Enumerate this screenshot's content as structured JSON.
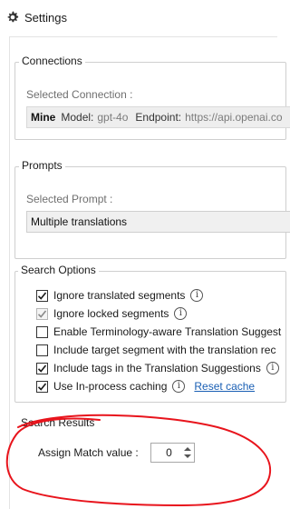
{
  "window": {
    "title": "Settings",
    "icon": "gear-icon"
  },
  "connections": {
    "legend": "Connections",
    "selected_label": "Selected Connection :",
    "name": "Mine",
    "model_key": "Model:",
    "model_value": "gpt-4o",
    "endpoint_key": "Endpoint:",
    "endpoint_value": "https://api.openai.co"
  },
  "prompts": {
    "legend": "Prompts",
    "selected_label": "Selected Prompt :",
    "selected_value": "Multiple translations"
  },
  "search_options": {
    "legend": "Search Options",
    "items": [
      {
        "label": "Ignore translated segments",
        "checked": true,
        "disabled": false,
        "info": true
      },
      {
        "label": "Ignore locked segments",
        "checked": true,
        "disabled": true,
        "info": true
      },
      {
        "label": "Enable Terminology-aware Translation Suggest",
        "checked": false,
        "disabled": false,
        "info": false
      },
      {
        "label": "Include target segment with the translation rec",
        "checked": false,
        "disabled": false,
        "info": false
      },
      {
        "label": "Include tags in the Translation Suggestions",
        "checked": true,
        "disabled": false,
        "info": true
      },
      {
        "label": "Use In-process caching",
        "checked": true,
        "disabled": false,
        "info": true
      }
    ],
    "reset_cache_label": "Reset cache"
  },
  "search_results": {
    "legend": "Search Results",
    "match_label": "Assign Match value :",
    "match_value": "0"
  },
  "colors": {
    "annotation": "#e8141c",
    "link": "#1a5fb4",
    "check": "#1a1a1a"
  }
}
